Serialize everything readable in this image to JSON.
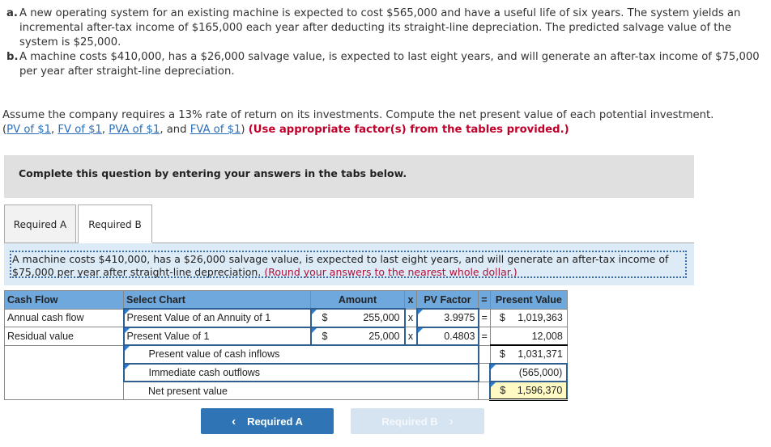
{
  "problem": {
    "items": [
      {
        "label": "a.",
        "text": "A new operating system for an existing machine is expected to cost $565,000 and have a useful life of six years. The system yields an incremental after-tax income of $165,000 each year after deducting its straight-line depreciation. The predicted salvage value of the system is $25,000."
      },
      {
        "label": "b.",
        "text": "A machine costs $410,000, has a $26,000 salvage value, is expected to last eight years, and will generate an after-tax income of $75,000 per year after straight-line depreciation."
      }
    ]
  },
  "assume": {
    "text": "Assume the company requires a 13% rate of return on its investments. Compute the net present value of each potential investment.",
    "open_paren": "(",
    "links": [
      "PV of $1",
      "FV of $1",
      "PVA of $1",
      "FVA of $1"
    ],
    "sep1": ", ",
    "sep2": ", ",
    "sep3": ", and ",
    "close_paren": ")",
    "instruction": "(Use appropriate factor(s) from the tables provided.)"
  },
  "banner": {
    "text": "Complete this question by entering your answers in the tabs below."
  },
  "tabs": [
    {
      "label": "Required A",
      "active": false
    },
    {
      "label": "Required B",
      "active": true
    }
  ],
  "instructions": {
    "text": "A machine costs $410,000, has a $26,000 salvage value, is expected to last eight years, and will generate an after-tax income of $75,000 per year after straight-line depreciation.",
    "round_note": "(Round your answers to the nearest whole dollar.)"
  },
  "table": {
    "headers": {
      "cash_flow": "Cash Flow",
      "select_chart": "Select Chart",
      "amount": "Amount",
      "x": "x",
      "pv_factor": "PV Factor",
      "eq": "=",
      "present_value": "Present Value"
    },
    "rows": [
      {
        "cash_flow": "Annual cash flow",
        "chart": "Present Value of an Annuity of 1",
        "currency": "$",
        "amount": "255,000",
        "x": "x",
        "factor": "3.9975",
        "eq": "=",
        "pv_currency": "$",
        "pv": "1,019,363"
      },
      {
        "cash_flow": "Residual value",
        "chart": "Present Value of 1",
        "currency": "$",
        "amount": "25,000",
        "x": "x",
        "factor": "0.4803",
        "eq": "=",
        "pv_currency": "",
        "pv": "12,008"
      }
    ],
    "summary": [
      {
        "label": "Present value of cash inflows",
        "currency": "$",
        "value": "1,031,371"
      },
      {
        "label": "Immediate cash outflows",
        "currency": "",
        "value": "(565,000)"
      },
      {
        "label": "Net present value",
        "currency": "$",
        "value": "1,596,370"
      }
    ]
  },
  "nav": {
    "prev_label": "Required A",
    "prev_icon": "‹",
    "next_label": "Required B",
    "next_icon": "›"
  }
}
